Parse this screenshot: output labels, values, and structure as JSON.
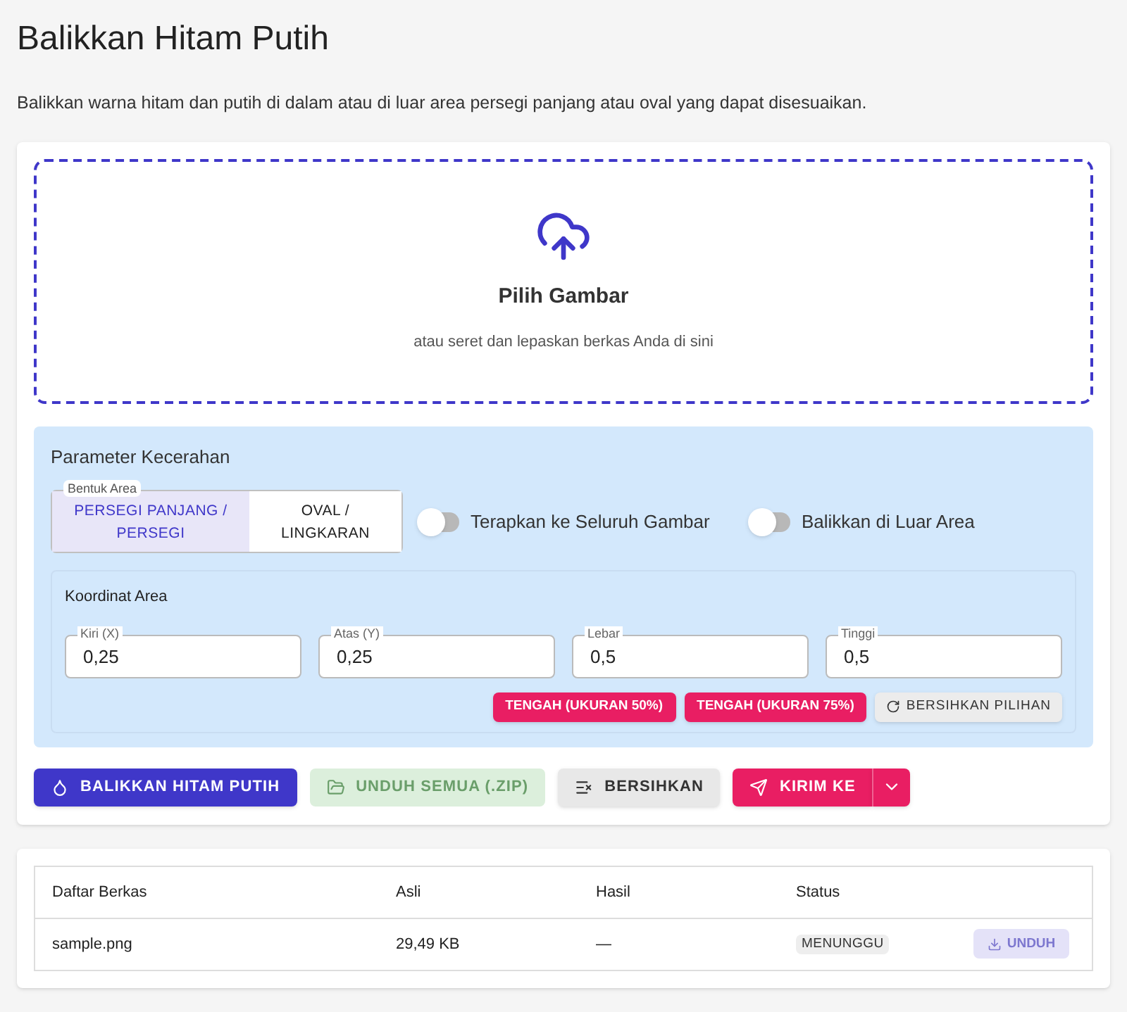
{
  "title": "Balikkan Hitam Putih",
  "description": "Balikkan warna hitam dan putih di dalam atau di luar area persegi panjang atau oval yang dapat disesuaikan.",
  "dropzone": {
    "title": "Pilih Gambar",
    "hint": "atau seret dan lepaskan berkas Anda di sini"
  },
  "parameters": {
    "title": "Parameter Kecerahan",
    "shape": {
      "legend": "Bentuk Area",
      "options": [
        {
          "label": "PERSEGI PANJANG / PERSEGI",
          "selected": true
        },
        {
          "label": "OVAL / LINGKARAN",
          "selected": false
        }
      ]
    },
    "switches": [
      {
        "label": "Terapkan ke Seluruh Gambar",
        "on": false
      },
      {
        "label": "Balikkan di Luar Area",
        "on": false
      }
    ],
    "coordinates": {
      "title": "Koordinat Area",
      "fields": [
        {
          "label": "Kiri (X)",
          "value": "0,25"
        },
        {
          "label": "Atas (Y)",
          "value": "0,25"
        },
        {
          "label": "Lebar",
          "value": "0,5"
        },
        {
          "label": "Tinggi",
          "value": "0,5"
        }
      ],
      "buttons": [
        {
          "label": "TENGAH (UKURAN 50%)",
          "kind": "accent"
        },
        {
          "label": "TENGAH (UKURAN 75%)",
          "kind": "accent"
        },
        {
          "label": "BERSIHKAN PILIHAN",
          "kind": "reset"
        }
      ]
    }
  },
  "actions": [
    {
      "label": "BALIKKAN HITAM PUTIH",
      "kind": "primary",
      "disabled": false
    },
    {
      "label": "UNDUH SEMUA (.ZIP)",
      "kind": "zip",
      "disabled": true
    },
    {
      "label": "BERSIHKAN",
      "kind": "clear",
      "disabled": false
    },
    {
      "label": "KIRIM KE",
      "kind": "send",
      "disabled": false
    }
  ],
  "table": {
    "columns": [
      "Daftar Berkas",
      "Asli",
      "Hasil",
      "Status"
    ],
    "rows": [
      {
        "name": "sample.png",
        "original": "29,49 KB",
        "result": "—",
        "status": "MENUNGGU",
        "download": {
          "label": "UNDUH",
          "disabled": true
        }
      }
    ]
  }
}
